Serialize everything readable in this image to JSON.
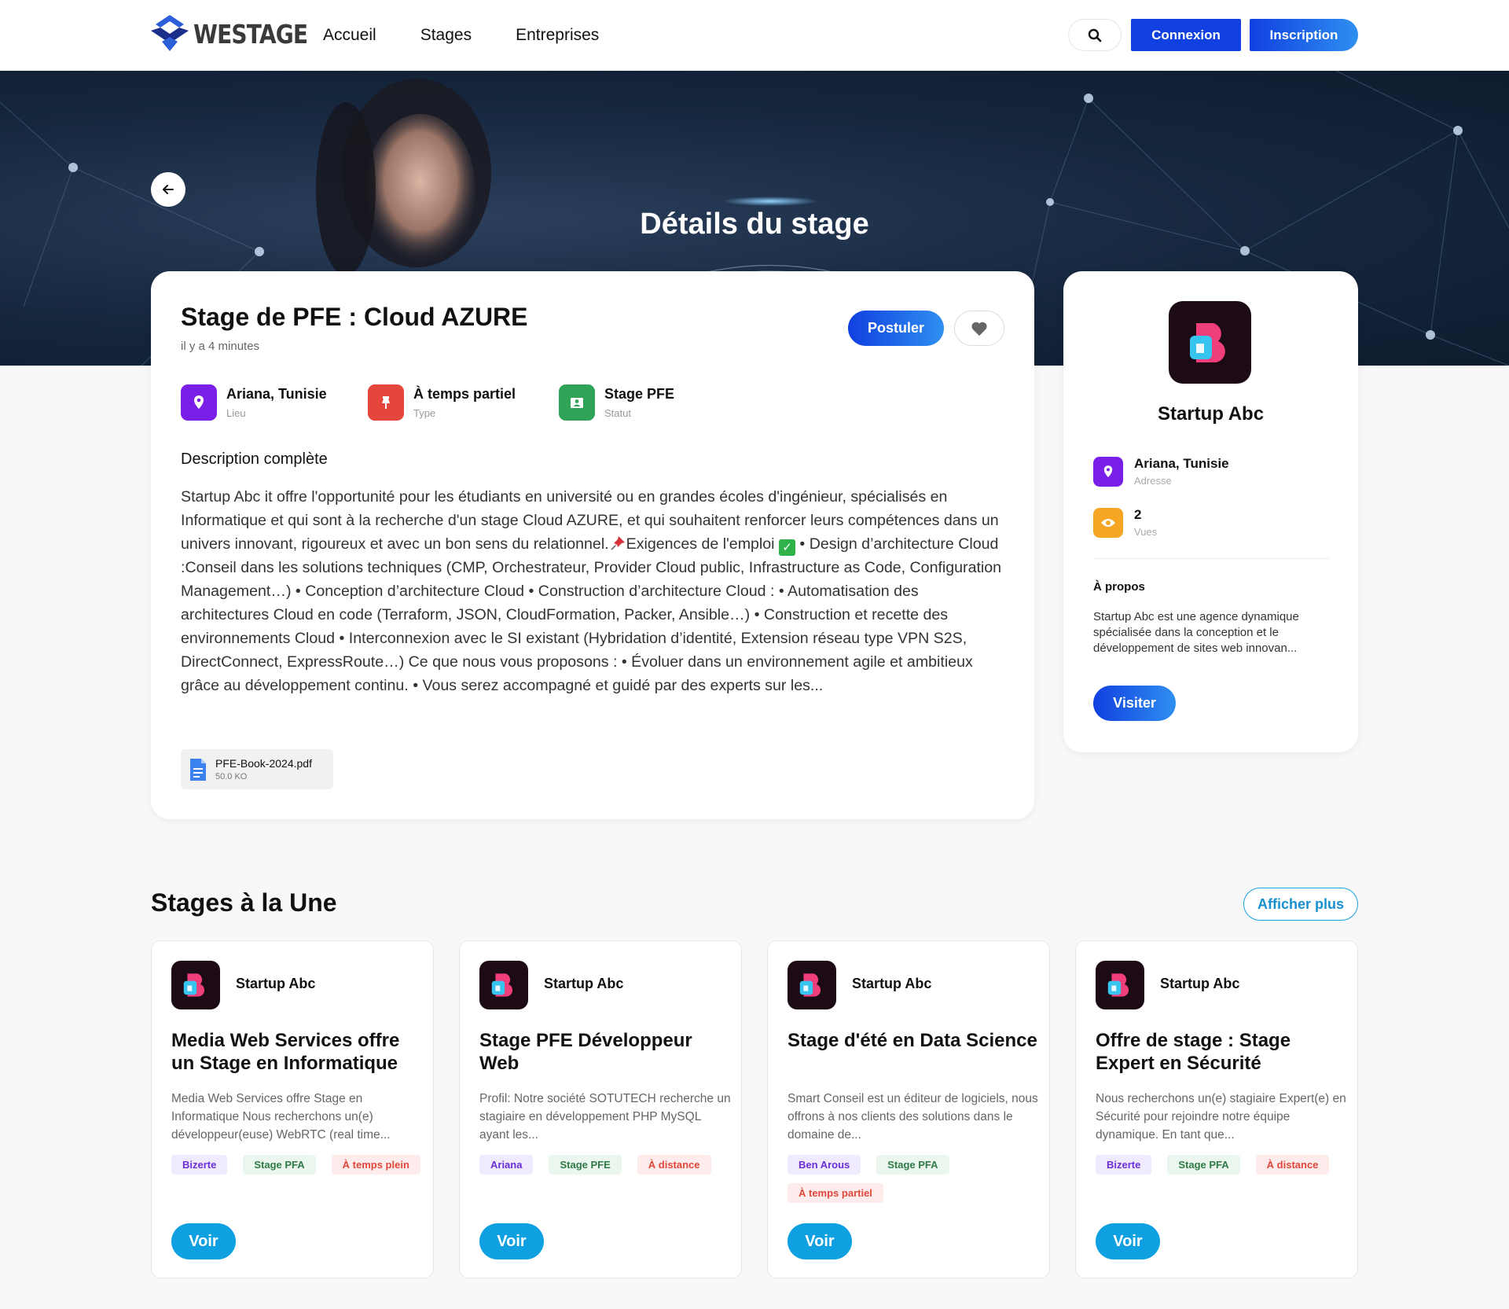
{
  "header": {
    "logo_text": "WESTAGE",
    "nav": [
      "Accueil",
      "Stages",
      "Entreprises"
    ],
    "login_label": "Connexion",
    "signup_label": "Inscription"
  },
  "hero": {
    "title": "Détails du stage"
  },
  "job": {
    "title": "Stage de PFE : Cloud AZURE",
    "posted": "il y a 4 minutes",
    "apply_label": "Postuler",
    "meta": [
      {
        "value": "Ariana, Tunisie",
        "label": "Lieu",
        "color": "#7a1fe8"
      },
      {
        "value": "À temps partiel",
        "label": "Type",
        "color": "#e4463c"
      },
      {
        "value": "Stage PFE",
        "label": "Statut",
        "color": "#2fa457"
      }
    ],
    "description_title": "Description complète",
    "description_part1": "Startup Abc it offre l'opportunité pour les étudiants en université ou en grandes écoles d'ingénieur, spécialisés en Informatique et qui sont à la recherche d'un stage Cloud AZURE, et qui souhaitent renforcer leurs compétences dans un univers innovant, rigoureux et avec un bon sens du relationnel.",
    "description_part2": "Exigences de l'emploi",
    "description_part3": " • Design d’architecture Cloud :Conseil dans les solutions techniques (CMP, Orchestrateur, Provider Cloud public, Infrastructure as Code, Configuration Management…) • Conception d’architecture Cloud • Construction d’architecture Cloud : • Automatisation des architectures Cloud en code (Terraform, JSON, CloudFormation, Packer, Ansible…) • Construction et recette des environnements Cloud • Interconnexion avec le SI existant (Hybridation d’identité, Extension réseau type VPN S2S, DirectConnect, ExpressRoute…) Ce que nous vous proposons : • Évoluer dans un environnement agile et ambitieux grâce au développement continu. • Vous serez accompagné et guidé par des experts sur les...",
    "file": {
      "name": "PFE-Book-2024.pdf",
      "size": "50.0 KO"
    }
  },
  "company": {
    "name": "Startup Abc",
    "address": "Ariana, Tunisie",
    "address_label": "Adresse",
    "views": "2",
    "views_label": "Vues",
    "about_title": "À propos",
    "about_text": "Startup Abc est une agence dynamique spécialisée dans la conception et le développement de sites web innovan...",
    "visit_label": "Visiter"
  },
  "featured": {
    "title": "Stages à la Une",
    "more_label": "Afficher plus",
    "voir_label": "Voir",
    "cards": [
      {
        "company": "Startup Abc",
        "title": "Media Web Services offre un Stage en Informatique",
        "description": "Media Web Services offre Stage en Informatique Nous recherchons un(e) développeur(euse) WebRTC (real time...",
        "tags": [
          {
            "text": "Bizerte",
            "kind": "purple"
          },
          {
            "text": "Stage PFA",
            "kind": "green"
          },
          {
            "text": "À temps plein",
            "kind": "red"
          }
        ]
      },
      {
        "company": "Startup Abc",
        "title": "Stage PFE Développeur Web",
        "description": "Profil: Notre société SOTUTECH recherche un stagiaire en développement PHP MySQL ayant les...",
        "tags": [
          {
            "text": "Ariana",
            "kind": "purple"
          },
          {
            "text": "Stage PFE",
            "kind": "green"
          },
          {
            "text": "À distance",
            "kind": "red"
          }
        ]
      },
      {
        "company": "Startup Abc",
        "title": "Stage d'été en Data Science",
        "description": "Smart Conseil est un éditeur de logiciels, nous offrons à nos clients des solutions dans le domaine de...",
        "tags": [
          {
            "text": "Ben Arous",
            "kind": "purple"
          },
          {
            "text": "Stage PFA",
            "kind": "green"
          },
          {
            "text": "À temps partiel",
            "kind": "red"
          }
        ]
      },
      {
        "company": "Startup Abc",
        "title": "Offre de stage : Stage Expert en Sécurité",
        "description": "Nous recherchons un(e) stagiaire Expert(e) en Sécurité pour rejoindre notre équipe dynamique. En tant que...",
        "tags": [
          {
            "text": "Bizerte",
            "kind": "purple"
          },
          {
            "text": "Stage PFA",
            "kind": "green"
          },
          {
            "text": "À distance",
            "kind": "red"
          }
        ]
      }
    ]
  }
}
